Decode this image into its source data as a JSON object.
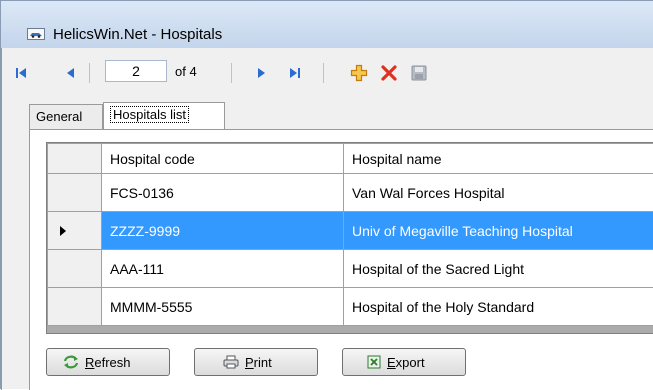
{
  "window": {
    "title": "HelicsWin.Net - Hospitals"
  },
  "navigator": {
    "position": "2",
    "count_label": "of 4"
  },
  "tabs": [
    {
      "label": "General",
      "active": false
    },
    {
      "label": "Hospitals list",
      "active": true
    }
  ],
  "grid": {
    "columns": [
      "Hospital code",
      "Hospital name"
    ],
    "rows": [
      {
        "code": "FCS-0136",
        "name": "Van Wal Forces Hospital",
        "selected": false
      },
      {
        "code": "ZZZZ-9999",
        "name": "Univ of Megaville Teaching Hospital",
        "selected": true
      },
      {
        "code": "AAA-111",
        "name": "Hospital of the Sacred Light",
        "selected": false
      },
      {
        "code": "MMMM-5555",
        "name": "Hospital of the Holy Standard",
        "selected": false
      }
    ]
  },
  "buttons": {
    "refresh": {
      "mnemonic": "R",
      "rest": "efresh"
    },
    "print": {
      "mnemonic": "P",
      "rest": "rint"
    },
    "export": {
      "mnemonic": "E",
      "rest": "xport"
    }
  },
  "colors": {
    "nav_blue": "#2a6ccf",
    "add_orange": "#f0a020",
    "delete_red": "#e0301e",
    "selection": "#3399ff"
  },
  "icons": {
    "title": "app-car-icon",
    "first": "first-record-icon",
    "prev": "previous-record-icon",
    "next": "next-record-icon",
    "last": "last-record-icon",
    "add": "add-plus-icon",
    "delete": "delete-x-icon",
    "save": "save-disk-icon",
    "refresh": "refresh-arrows-icon",
    "print": "printer-icon",
    "export": "excel-export-icon"
  }
}
